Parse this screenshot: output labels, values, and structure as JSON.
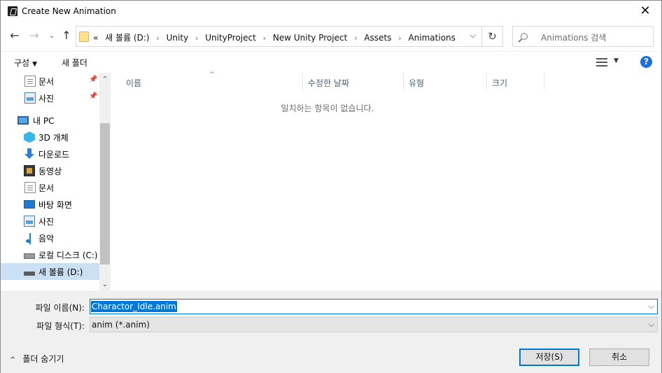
{
  "window": {
    "title": "Create New Animation",
    "close_glyph": "✕"
  },
  "nav": {
    "back_glyph": "←",
    "forward_glyph": "→",
    "recent_glyph": "⌄",
    "up_glyph": "↑",
    "breadcrumbs": [
      "«",
      "새 볼륨 (D:)",
      "Unity",
      "UnityProject",
      "New Unity Project",
      "Assets",
      "Animations"
    ],
    "crumb_sep": "›",
    "dropdown_glyph": "⌵",
    "refresh_glyph": "↻",
    "search_placeholder": "Animations 검색"
  },
  "command_bar": {
    "organize_label": "구성",
    "organize_caret": "▼",
    "new_folder_label": "새 폴더",
    "view_caret": "▼",
    "help_label": "?"
  },
  "sidebar": {
    "pin_glyph": "📌",
    "items": [
      {
        "label": "문서",
        "icon": "document-icon",
        "pinned": true
      },
      {
        "label": "사진",
        "icon": "pictures-icon",
        "pinned": true
      },
      {
        "label": "내 PC",
        "icon": "pc-icon"
      },
      {
        "label": "3D 개체",
        "icon": "3d-objects-icon"
      },
      {
        "label": "다운로드",
        "icon": "download-icon"
      },
      {
        "label": "동영상",
        "icon": "video-icon"
      },
      {
        "label": "문서",
        "icon": "document-icon"
      },
      {
        "label": "바탕 화면",
        "icon": "desktop-icon"
      },
      {
        "label": "사진",
        "icon": "pictures-icon"
      },
      {
        "label": "음악",
        "icon": "music-icon"
      },
      {
        "label": "로컬 디스크 (C:)",
        "icon": "local-disk-icon"
      },
      {
        "label": "새 볼륨 (D:)",
        "icon": "drive-icon",
        "selected": true
      }
    ],
    "scroll_up_glyph": "⌃",
    "scroll_down_glyph": "⌄"
  },
  "file_list": {
    "columns": [
      "이름",
      "수정한 날짜",
      "유형",
      "크기"
    ],
    "sort_glyph": "^",
    "empty_message": "일치하는 항목이 없습니다."
  },
  "form": {
    "filename_label": "파일 이름(N):",
    "filename_value": "Charactor_Idle.anim",
    "filetype_label": "파일 형식(T):",
    "filetype_value": "anim (*.anim)",
    "dropdown_glyph": "⌵",
    "hide_folders_label": "폴더 숨기기",
    "hide_folders_caret": "^",
    "save_label": "저장(S)",
    "cancel_label": "취소"
  },
  "colors": {
    "accent": "#0078d7",
    "selection": "#cce0f5",
    "help": "#1d6fe3"
  }
}
